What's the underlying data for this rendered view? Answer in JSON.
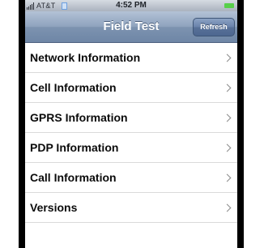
{
  "status_bar": {
    "carrier": "AT&T",
    "time": "4:52 PM"
  },
  "nav_bar": {
    "title": "Field Test",
    "refresh_label": "Refresh"
  },
  "menu": {
    "items": [
      {
        "label": "Network Information"
      },
      {
        "label": "Cell Information"
      },
      {
        "label": "GPRS Information"
      },
      {
        "label": "PDP Information"
      },
      {
        "label": "Call Information"
      },
      {
        "label": "Versions"
      }
    ]
  },
  "icons": {
    "signal": "signal-bars-icon",
    "wifi": "wifi-icon",
    "battery": "battery-icon",
    "disclosure": "chevron-right-icon"
  },
  "colors": {
    "nav_bar": "#8ea2bd",
    "refresh_button": "#587198",
    "battery": "#58d04a"
  }
}
